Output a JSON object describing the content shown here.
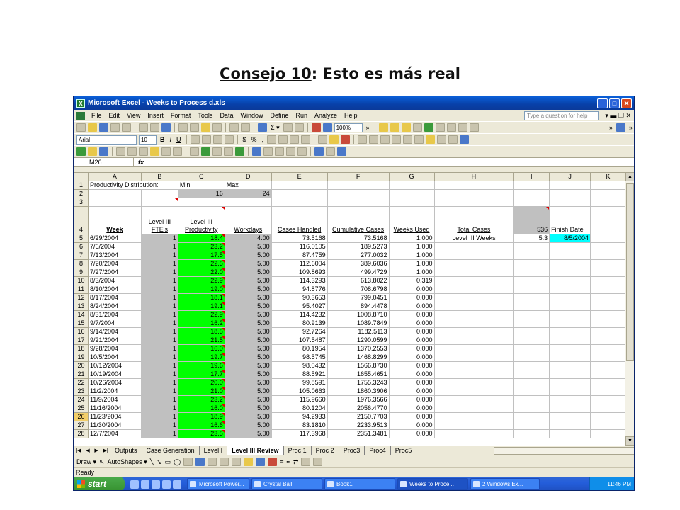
{
  "slide": {
    "title_underlined": "Consejo 10",
    "title_rest": ": Esto es más real"
  },
  "window": {
    "title": "Microsoft Excel - Weeks to Process d.xls"
  },
  "menu": {
    "items": [
      "File",
      "Edit",
      "View",
      "Insert",
      "Format",
      "Tools",
      "Data",
      "Window",
      "Define",
      "Run",
      "Analyze",
      "Help"
    ],
    "ask_placeholder": "Type a question for help"
  },
  "toolbar": {
    "zoom": "100%",
    "font": "Arial",
    "size": "10"
  },
  "formula_bar": {
    "name_box": "M26",
    "fx": "fx"
  },
  "columns": [
    "A",
    "B",
    "C",
    "D",
    "E",
    "F",
    "G",
    "H",
    "I",
    "J",
    "K"
  ],
  "sheet": {
    "r1": {
      "a": "Productivity Distribution:",
      "c": "Min",
      "d": "Max"
    },
    "r2": {
      "c": "16",
      "d": "24"
    },
    "headers": {
      "week": "Week",
      "fte": "Level III FTE's",
      "prod": "Level III Productivity",
      "workdays": "Workdays",
      "cases": "Cases Handled",
      "cumulative": "Cumulative Cases",
      "weeks_used": "Weeks Used",
      "total_cases": "Total Cases",
      "total_val": "536",
      "finish": "Finish Date"
    },
    "side": {
      "label": "Level III Weeks",
      "value": "5.3",
      "finish_date": "8/5/2004"
    },
    "rows": [
      {
        "n": "5",
        "week": "6/29/2004",
        "fte": "1",
        "prod": "18.4",
        "wd": "4.00",
        "cases": "73.5168",
        "cum": "73.5168",
        "used": "1.000"
      },
      {
        "n": "6",
        "week": "7/6/2004",
        "fte": "1",
        "prod": "23.2",
        "wd": "5.00",
        "cases": "116.0105",
        "cum": "189.5273",
        "used": "1.000"
      },
      {
        "n": "7",
        "week": "7/13/2004",
        "fte": "1",
        "prod": "17.5",
        "wd": "5.00",
        "cases": "87.4759",
        "cum": "277.0032",
        "used": "1.000"
      },
      {
        "n": "8",
        "week": "7/20/2004",
        "fte": "1",
        "prod": "22.5",
        "wd": "5.00",
        "cases": "112.6004",
        "cum": "389.6036",
        "used": "1.000"
      },
      {
        "n": "9",
        "week": "7/27/2004",
        "fte": "1",
        "prod": "22.0",
        "wd": "5.00",
        "cases": "109.8693",
        "cum": "499.4729",
        "used": "1.000"
      },
      {
        "n": "10",
        "week": "8/3/2004",
        "fte": "1",
        "prod": "22.9",
        "wd": "5.00",
        "cases": "114.3293",
        "cum": "613.8022",
        "used": "0.319"
      },
      {
        "n": "11",
        "week": "8/10/2004",
        "fte": "1",
        "prod": "19.0",
        "wd": "5.00",
        "cases": "94.8776",
        "cum": "708.6798",
        "used": "0.000"
      },
      {
        "n": "12",
        "week": "8/17/2004",
        "fte": "1",
        "prod": "18.1",
        "wd": "5.00",
        "cases": "90.3653",
        "cum": "799.0451",
        "used": "0.000"
      },
      {
        "n": "13",
        "week": "8/24/2004",
        "fte": "1",
        "prod": "19.1",
        "wd": "5.00",
        "cases": "95.4027",
        "cum": "894.4478",
        "used": "0.000"
      },
      {
        "n": "14",
        "week": "8/31/2004",
        "fte": "1",
        "prod": "22.9",
        "wd": "5.00",
        "cases": "114.4232",
        "cum": "1008.8710",
        "used": "0.000"
      },
      {
        "n": "15",
        "week": "9/7/2004",
        "fte": "1",
        "prod": "16.2",
        "wd": "5.00",
        "cases": "80.9139",
        "cum": "1089.7849",
        "used": "0.000"
      },
      {
        "n": "16",
        "week": "9/14/2004",
        "fte": "1",
        "prod": "18.5",
        "wd": "5.00",
        "cases": "92.7264",
        "cum": "1182.5113",
        "used": "0.000"
      },
      {
        "n": "17",
        "week": "9/21/2004",
        "fte": "1",
        "prod": "21.5",
        "wd": "5.00",
        "cases": "107.5487",
        "cum": "1290.0599",
        "used": "0.000"
      },
      {
        "n": "18",
        "week": "9/28/2004",
        "fte": "1",
        "prod": "16.0",
        "wd": "5.00",
        "cases": "80.1954",
        "cum": "1370.2553",
        "used": "0.000"
      },
      {
        "n": "19",
        "week": "10/5/2004",
        "fte": "1",
        "prod": "19.7",
        "wd": "5.00",
        "cases": "98.5745",
        "cum": "1468.8299",
        "used": "0.000"
      },
      {
        "n": "20",
        "week": "10/12/2004",
        "fte": "1",
        "prod": "19.6",
        "wd": "5.00",
        "cases": "98.0432",
        "cum": "1566.8730",
        "used": "0.000"
      },
      {
        "n": "21",
        "week": "10/19/2004",
        "fte": "1",
        "prod": "17.7",
        "wd": "5.00",
        "cases": "88.5921",
        "cum": "1655.4651",
        "used": "0.000"
      },
      {
        "n": "22",
        "week": "10/26/2004",
        "fte": "1",
        "prod": "20.0",
        "wd": "5.00",
        "cases": "99.8591",
        "cum": "1755.3243",
        "used": "0.000"
      },
      {
        "n": "23",
        "week": "11/2/2004",
        "fte": "1",
        "prod": "21.0",
        "wd": "5.00",
        "cases": "105.0663",
        "cum": "1860.3906",
        "used": "0.000"
      },
      {
        "n": "24",
        "week": "11/9/2004",
        "fte": "1",
        "prod": "23.2",
        "wd": "5.00",
        "cases": "115.9660",
        "cum": "1976.3566",
        "used": "0.000"
      },
      {
        "n": "25",
        "week": "11/16/2004",
        "fte": "1",
        "prod": "16.0",
        "wd": "5.00",
        "cases": "80.1204",
        "cum": "2056.4770",
        "used": "0.000"
      },
      {
        "n": "26",
        "week": "11/23/2004",
        "fte": "1",
        "prod": "18.9",
        "wd": "5.00",
        "cases": "94.2933",
        "cum": "2150.7703",
        "used": "0.000"
      },
      {
        "n": "27",
        "week": "11/30/2004",
        "fte": "1",
        "prod": "16.6",
        "wd": "5.00",
        "cases": "83.1810",
        "cum": "2233.9513",
        "used": "0.000"
      },
      {
        "n": "28",
        "week": "12/7/2004",
        "fte": "1",
        "prod": "23.5",
        "wd": "5.00",
        "cases": "117.3968",
        "cum": "2351.3481",
        "used": "0.000"
      }
    ]
  },
  "tabs": [
    "Outputs",
    "Case Generation",
    "Level I",
    "Level III Review",
    "Proc 1",
    "Proc 2",
    "Proc3",
    "Proc4",
    "Proc5"
  ],
  "active_tab": "Level III Review",
  "drawbar": {
    "draw": "Draw",
    "autoshapes": "AutoShapes"
  },
  "status": "Ready",
  "taskbar": {
    "start": "start",
    "tasks": [
      "Microsoft Power...",
      "Crystal Ball",
      "Book1",
      "Weeks to Proce...",
      "2 Windows Ex..."
    ],
    "clock": "11:46 PM"
  },
  "colors": {
    "green": "#00ff00",
    "cyan": "#00ffff",
    "gray": "#c0c0c0",
    "titlebar": "#0a5fd8"
  }
}
